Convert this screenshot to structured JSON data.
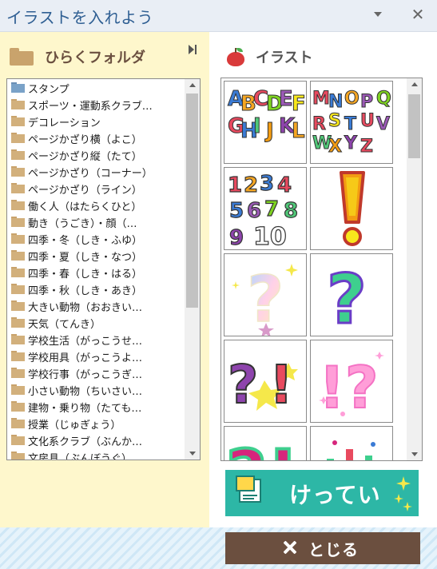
{
  "window": {
    "title": "イラストを入れよう"
  },
  "folder_panel": {
    "title": "ひらくフォルダ",
    "items": [
      "スタンプ",
      "スポーツ・運動系クラブ…",
      "デコレーション",
      "ページかざり横（よこ）",
      "ページかざり縦（たて）",
      "ページかざり（コーナー）",
      "ページかざり（ライン）",
      "働く人（はたらくひと）",
      "動き（うごき）・顔（…",
      "四季・冬（しき・ふゆ）",
      "四季・夏（しき・なつ）",
      "四季・春（しき・はる）",
      "四季・秋（しき・あき）",
      "大きい動物（おおきい…",
      "天気（てんき）",
      "学校生活（がっこうせ…",
      "学校用具（がっこうよ…",
      "学校行事（がっこうぎ…",
      "小さい動物（ちいさい…",
      "建物・乗り物（たても…",
      "授業（じゅぎょう）",
      "文化系クラブ（ぶんか…",
      "文房具（ぶんぼうぐ）"
    ]
  },
  "illust_panel": {
    "title": "イラスト",
    "tiles": [
      {
        "icon": "alphabet-a-to-l-illustration",
        "text": "ABCDEFGHIJKL"
      },
      {
        "icon": "alphabet-m-to-z-illustration",
        "text": "MNOPQRSTUVWXYZ"
      },
      {
        "icon": "numbers-1-to-10-illustration",
        "text": "12345678910"
      },
      {
        "icon": "exclamation-mark-illustration",
        "text": "!"
      },
      {
        "icon": "pastel-question-mark-illustration",
        "text": "?"
      },
      {
        "icon": "green-question-mark-illustration",
        "text": "?"
      },
      {
        "icon": "question-exclamation-illustration",
        "text": "?!"
      },
      {
        "icon": "pink-exclamation-question-illustration",
        "text": "!?"
      },
      {
        "icon": "green-question-exclamation-partial-illustration",
        "text": "?!"
      },
      {
        "icon": "colorful-marks-partial-illustration",
        "text": ""
      }
    ]
  },
  "buttons": {
    "confirm_label": "けってい",
    "close_label": "とじる"
  },
  "colors": {
    "title_text": "#2f5f93",
    "left_panel_bg": "#fef7cc",
    "confirm_bg": "#2db7a6",
    "close_bg": "#6b4f3f"
  }
}
